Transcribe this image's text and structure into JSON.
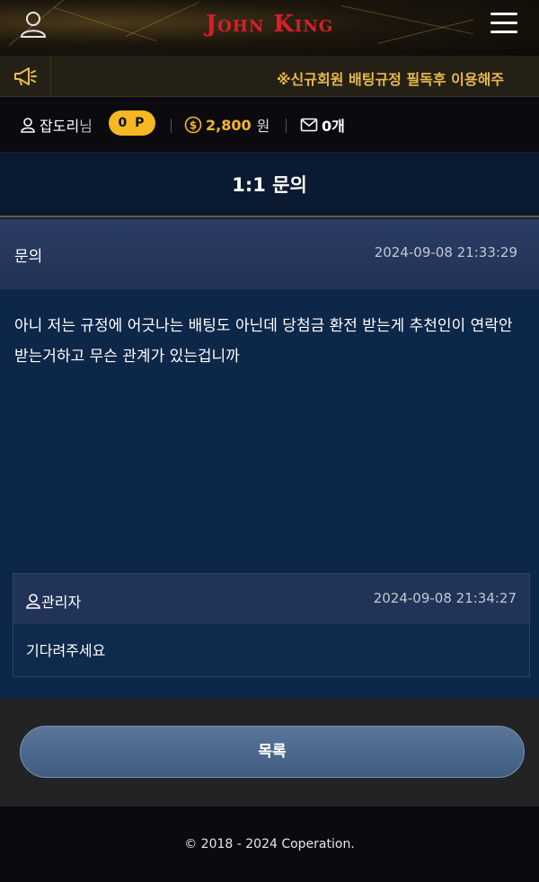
{
  "header": {
    "logo": "John King",
    "user_icon": "user-icon",
    "menu_icon": "hamburger-menu-icon"
  },
  "notice": {
    "icon": "megaphone-icon",
    "text": "※신규회원 배팅규정 필독후 이용해주"
  },
  "userbar": {
    "nickname": "잡도리",
    "nickname_suffix": "님",
    "points": "0 P",
    "money": "2,800",
    "money_unit": "원",
    "messages": "0개"
  },
  "page": {
    "title": "1:1 문의"
  },
  "inquiry": {
    "label": "문의",
    "date": "2024-09-08 21:33:29",
    "body": "아니 저는 규정에 어긋나는 배팅도 아닌데 당첨금 환전 받는게 추천인이 연락안받는거하고 무슨 관계가 있는겁니까"
  },
  "reply": {
    "author": "관리자",
    "date": "2024-09-08 21:34:27",
    "text": "기다려주세요"
  },
  "actions": {
    "list_button": "목록"
  },
  "footer": {
    "copyright": "© 2018 - 2024 Coperation."
  },
  "colors": {
    "brand_red": "#d81e2c",
    "accent_gold": "#f5b823",
    "navy": "#0d2748"
  }
}
